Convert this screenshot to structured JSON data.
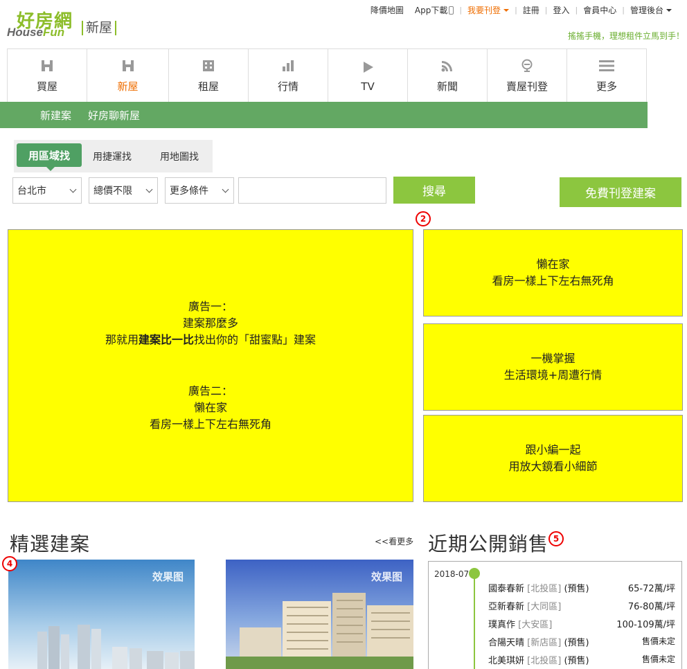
{
  "header": {
    "logo_cn": "好房網",
    "logo_en_prefix": "House",
    "logo_en_suffix": "Fun",
    "logo_sub": "新屋",
    "links": {
      "price_map": "降價地圖",
      "app_download": "App下載",
      "post_listing": "我要刊登",
      "register": "註冊",
      "login": "登入",
      "member_center": "會員中心",
      "admin": "管理後台"
    },
    "tagline": "搖搖手機，理想租件立馬到手！"
  },
  "nav": {
    "items": [
      {
        "label": "買屋",
        "icon": "house-icon"
      },
      {
        "label": "新屋",
        "icon": "house-icon"
      },
      {
        "label": "租屋",
        "icon": "building-icon"
      },
      {
        "label": "行情",
        "icon": "bar-chart-icon"
      },
      {
        "label": "TV",
        "icon": "play-icon"
      },
      {
        "label": "新聞",
        "icon": "rss-icon"
      },
      {
        "label": "賣屋刊登",
        "icon": "megaphone-icon"
      },
      {
        "label": "更多",
        "icon": "menu-icon"
      }
    ],
    "active": "新屋"
  },
  "subnav": {
    "items": [
      "新建案",
      "好房聊新屋"
    ]
  },
  "search": {
    "tabs": [
      "用區域找",
      "用捷運找",
      "用地圖找"
    ],
    "active_tab": "用區域找",
    "city": "台北市",
    "price": "總價不限",
    "more": "更多條件",
    "keyword_value": "",
    "search_label": "搜尋",
    "free_post_label": "免費刊登建案"
  },
  "markers": {
    "m2": "2",
    "m4": "4",
    "m5": "5"
  },
  "ads": {
    "big": {
      "ad1_title": "廣告一：",
      "ad1_line1": "建案那麼多",
      "ad1_line2_pre": "那就用",
      "ad1_line2_bold": "建案比一比",
      "ad1_line2_post": "找出你的「甜蜜點」建案",
      "ad2_title": "廣告二：",
      "ad2_line1": "懶在家",
      "ad2_line2": "看房一樣上下左右無死角"
    },
    "side": [
      {
        "line1": "懶在家",
        "line2": "看房一樣上下左右無死角"
      },
      {
        "line1": "一機掌握",
        "line2": "生活環境+周遭行情"
      },
      {
        "line1": "跟小編一起",
        "line2": "用放大鏡看小細節"
      }
    ]
  },
  "featured": {
    "title": "精選建案",
    "more": "<<看更多",
    "cards": [
      {
        "badge": "效果图"
      },
      {
        "badge": "效果图"
      }
    ]
  },
  "recent": {
    "title": "近期公開銷售",
    "date": "2018-07",
    "rows": [
      {
        "name": "國泰春新",
        "district": "[北投區]",
        "note": "(預售)",
        "price": "65-72萬/坪"
      },
      {
        "name": "亞新春新",
        "district": "[大同區]",
        "note": "",
        "price": "76-80萬/坪"
      },
      {
        "name": "璞真作",
        "district": "[大安區]",
        "note": "",
        "price": "100-109萬/坪"
      },
      {
        "name": "合陽天晴",
        "district": "[新店區]",
        "note": "(預售)",
        "price": "售價未定"
      },
      {
        "name": "北美琪妍",
        "district": "[北投區]",
        "note": "(預售)",
        "price": "售價未定"
      }
    ]
  },
  "colors": {
    "brand_green": "#8cc63f",
    "subnav_green": "#63a863",
    "tab_green": "#4fa063",
    "accent_orange": "#ef6d00",
    "ad_yellow": "#ffff00",
    "marker_red": "#ee0000"
  }
}
